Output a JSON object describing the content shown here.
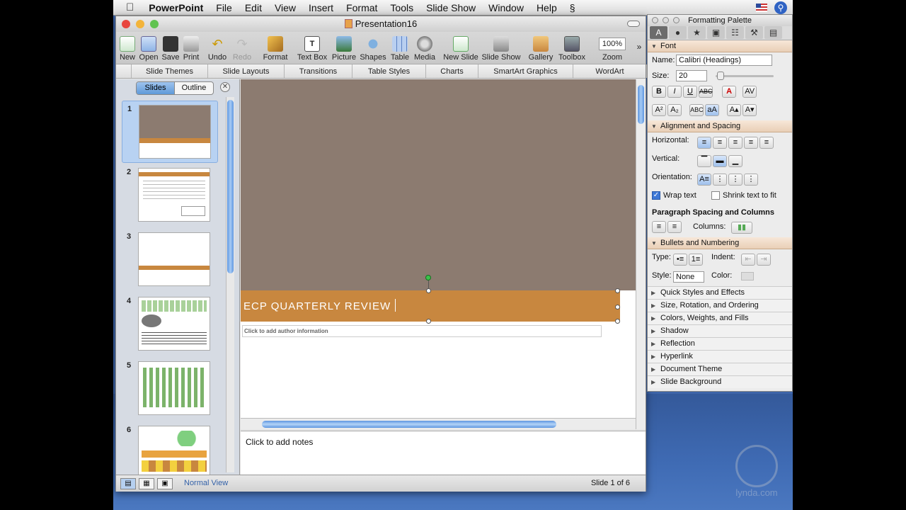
{
  "menubar": {
    "app_name": "PowerPoint",
    "items": [
      "File",
      "Edit",
      "View",
      "Insert",
      "Format",
      "Tools",
      "Slide Show",
      "Window",
      "Help"
    ]
  },
  "window": {
    "title": "Presentation16"
  },
  "toolbar": {
    "buttons": [
      "New",
      "Open",
      "Save",
      "Print",
      "Undo",
      "Redo",
      "Format",
      "Text Box",
      "Picture",
      "Shapes",
      "Table",
      "Media",
      "New Slide",
      "Slide Show",
      "Gallery",
      "Toolbox"
    ],
    "zoom_value": "100%",
    "zoom_label": "Zoom"
  },
  "ribbon": {
    "tabs": [
      "Slide Themes",
      "Slide Layouts",
      "Transitions",
      "Table Styles",
      "Charts",
      "SmartArt Graphics",
      "WordArt"
    ]
  },
  "slides_pane": {
    "tab_slides": "Slides",
    "tab_outline": "Outline",
    "thumbnail_numbers": [
      "1",
      "2",
      "3",
      "4",
      "5",
      "6"
    ],
    "selected": "1"
  },
  "slide": {
    "title": "ECP QUARTERLY REVIEW",
    "author_placeholder": "Click to add author information"
  },
  "notes_placeholder": "Click to add notes",
  "status": {
    "view_name": "Normal View",
    "slide_count": "Slide 1 of 6"
  },
  "palette": {
    "title": "Formatting Palette",
    "font_section": "Font",
    "name_label": "Name:",
    "font_name": "Calibri (Headings)",
    "size_label": "Size:",
    "font_size": "20",
    "align_section": "Alignment and Spacing",
    "horizontal_label": "Horizontal:",
    "vertical_label": "Vertical:",
    "orientation_label": "Orientation:",
    "wrap_text": "Wrap text",
    "shrink_text": "Shrink text to fit",
    "para_spacing": "Paragraph Spacing and Columns",
    "columns_label": "Columns:",
    "bullets_section": "Bullets and Numbering",
    "type_label": "Type:",
    "indent_label": "Indent:",
    "style_label": "Style:",
    "style_value": "None",
    "color_label": "Color:",
    "collapsed_sections": [
      "Quick Styles and Effects",
      "Size, Rotation, and Ordering",
      "Colors, Weights, and Fills",
      "Shadow",
      "Reflection",
      "Hyperlink",
      "Document Theme",
      "Slide Background"
    ]
  },
  "colors": {
    "slide_bg": "#8c7b70",
    "title_band": "#c8873f",
    "desktop": "#3d64a8"
  },
  "watermark": "lynda.com"
}
